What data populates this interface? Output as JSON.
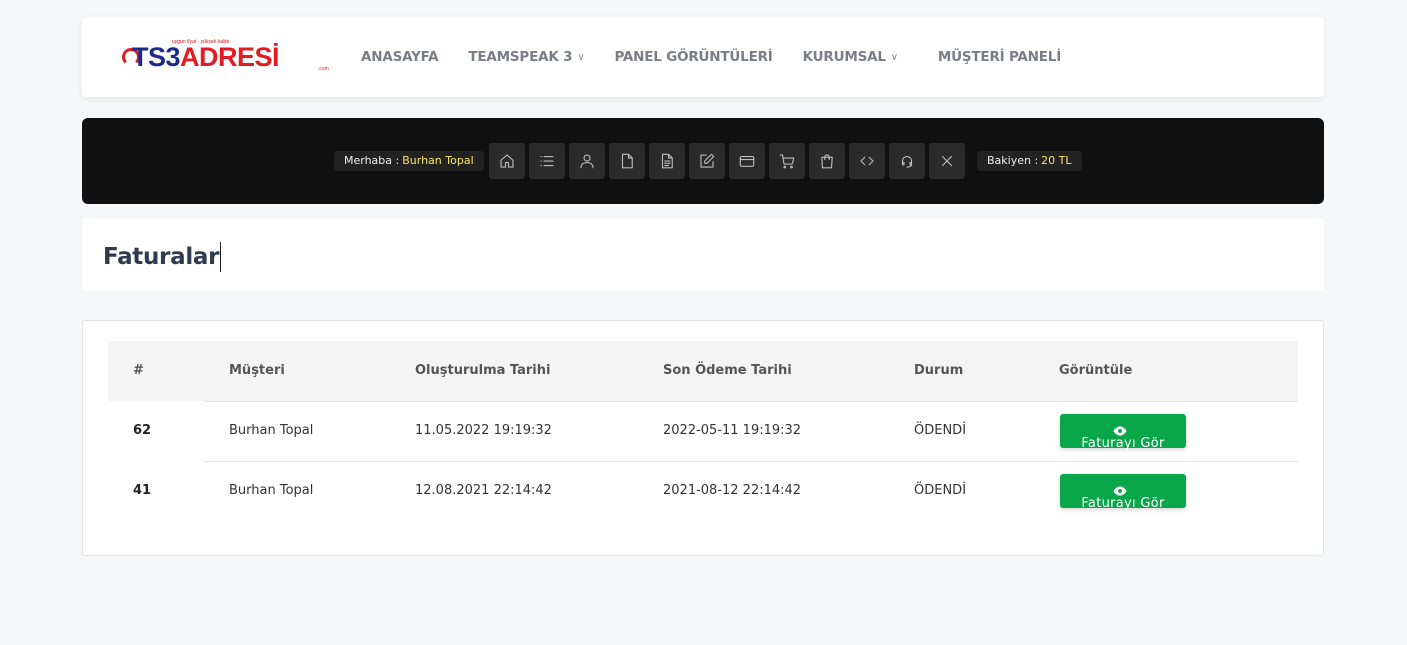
{
  "logo": {
    "tagline": "uygun fiyat · yüksek kalite",
    "brand_ts": "TS3",
    "brand_rest": "ADRESİ",
    "domain": ".com"
  },
  "nav": {
    "items": [
      {
        "label": "ANASAYFA",
        "dropdown": false
      },
      {
        "label": "TEAMSPEAK 3",
        "dropdown": true
      },
      {
        "label": "PANEL GÖRÜNTÜLERİ",
        "dropdown": false
      },
      {
        "label": "KURUMSAL",
        "dropdown": true
      },
      {
        "label": "MÜŞTERİ PANELİ",
        "dropdown": false
      }
    ],
    "dropdown_glyph": "∨"
  },
  "toolbar": {
    "greeting_label": "Merhaba :",
    "user_name": "Burhan Topal",
    "balance_label": "Bakiyen :",
    "balance_value": "20 TL",
    "icons": [
      "home-icon",
      "list-icon",
      "user-icon",
      "file-icon",
      "document-icon",
      "edit-icon",
      "credit-card-icon",
      "cart-icon",
      "bag-icon",
      "code-icon",
      "support-icon",
      "close-icon"
    ]
  },
  "page": {
    "title": "Faturalar"
  },
  "table": {
    "headers": [
      "#",
      "Müşteri",
      "Oluşturulma Tarihi",
      "Son Ödeme Tarihi",
      "Durum",
      "Görüntüle"
    ],
    "rows": [
      {
        "id": "62",
        "customer": "Burhan Topal",
        "created": "11.05.2022 19:19:32",
        "due": "2022-05-11 19:19:32",
        "status": "ÖDENDİ",
        "action": "Faturayı Gör"
      },
      {
        "id": "41",
        "customer": "Burhan Topal",
        "created": "12.08.2021 22:14:42",
        "due": "2021-08-12 22:14:42",
        "status": "ÖDENDİ",
        "action": "Faturayı Gör"
      }
    ]
  },
  "colors": {
    "accent_green": "#0aa64a",
    "toolbar_bg": "#101010",
    "highlight_yellow": "#f5e663",
    "title_color": "#2f3a4f"
  }
}
